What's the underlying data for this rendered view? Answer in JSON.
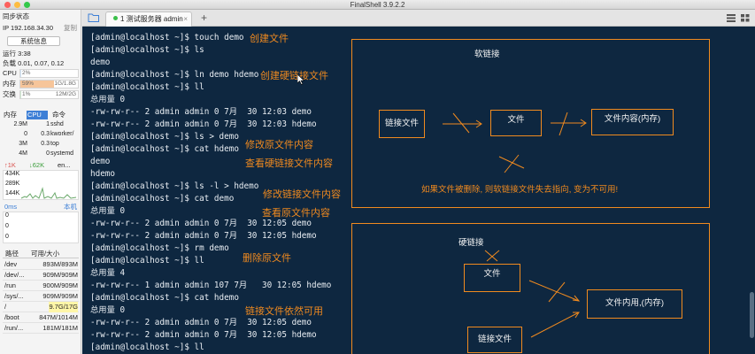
{
  "window": {
    "title": "FinalShell 3.9.2.2"
  },
  "sidebar": {
    "sync_status": "同步状态",
    "ip_label": "IP 192.168.34.30",
    "copy_label": "复制",
    "sysinfo_button": "系统信息",
    "uptime": "运行 3:38",
    "load": "负载 0.01, 0.07, 0.12",
    "cpu": {
      "label": "CPU",
      "percent": "2%",
      "fraction": 0.02
    },
    "mem": {
      "label": "内存",
      "percent": "59%",
      "value": "1G/1.8G",
      "fraction": 0.59
    },
    "swap": {
      "label": "交换",
      "percent": "1%",
      "value": "12M/2G",
      "fraction": 0.01
    },
    "proc_headers": {
      "mem": "内存",
      "cpu": "CPU",
      "cmd": "命令"
    },
    "processes": [
      {
        "mem": "2.9M",
        "cpu": "1",
        "cmd": "sshd"
      },
      {
        "mem": "0",
        "cpu": "0.3",
        "cmd": "kworker/"
      },
      {
        "mem": "3M",
        "cpu": "0.3",
        "cmd": "top"
      },
      {
        "mem": "4M",
        "cpu": "0",
        "cmd": "systemd"
      }
    ],
    "net": {
      "up": "↑1K",
      "down": "↓62K",
      "iface": "en...",
      "scale": [
        "434K",
        "289K",
        "144K"
      ]
    },
    "latency": {
      "label": "0ms",
      "host": "本机",
      "scale": [
        "0",
        "0",
        "0"
      ]
    },
    "disk_headers": {
      "path": "路径",
      "usage": "可用/大小"
    },
    "disks": [
      {
        "path": "/dev",
        "usage": "893M/893M"
      },
      {
        "path": "/dev/...",
        "usage": "909M/909M"
      },
      {
        "path": "/run",
        "usage": "900M/909M"
      },
      {
        "path": "/sys/...",
        "usage": "909M/909M"
      },
      {
        "path": "/",
        "usage": "9.7G/17G"
      },
      {
        "path": "/boot",
        "usage": "847M/1014M"
      },
      {
        "path": "/run/...",
        "usage": "181M/181M"
      }
    ]
  },
  "tabs": [
    {
      "label": "1 测试服务器 admin"
    }
  ],
  "terminal": {
    "lines": [
      "[admin@localhost ~]$ touch demo",
      "[admin@localhost ~]$ ls",
      "demo",
      "[admin@localhost ~]$ ln demo hdemo",
      "[admin@localhost ~]$ ll",
      "总用量 0",
      "-rw-rw-r-- 2 admin admin 0 7月  30 12:03 demo",
      "-rw-rw-r-- 2 admin admin 0 7月  30 12:03 hdemo",
      "[admin@localhost ~]$ ls > demo",
      "[admin@localhost ~]$ cat hdemo",
      "demo",
      "hdemo",
      "[admin@localhost ~]$ ls -l > hdemo",
      "[admin@localhost ~]$ cat demo",
      "总用量 0",
      "-rw-rw-r-- 2 admin admin 0 7月  30 12:05 demo",
      "-rw-rw-r-- 2 admin admin 0 7月  30 12:05 hdemo",
      "[admin@localhost ~]$ rm demo",
      "[admin@localhost ~]$ ll",
      "总用量 4",
      "-rw-rw-r-- 1 admin admin 107 7月   30 12:05 hdemo",
      "[admin@localhost ~]$ cat hdemo",
      "总用量 0",
      "-rw-rw-r-- 2 admin admin 0 7月  30 12:05 demo",
      "-rw-rw-r-- 2 admin admin 0 7月  30 12:05 hdemo",
      "[admin@localhost ~]$ ll"
    ],
    "notes": [
      "创建文件",
      "创建硬链接文件",
      "修改原文件内容",
      "查看硬链接文件内容",
      "修改链接文件内容",
      "查看原文件内容",
      "删除原文件",
      "链接文件依然可用"
    ],
    "softlink_panel": {
      "title": "软链接",
      "link_box": "链接文件",
      "file_box": "文件",
      "content_box": "文件内容(内存)",
      "caption": "如果文件被删除, 则软链接文件失去指向, 变为不可用!"
    },
    "hardlink_panel": {
      "title": "硬链接",
      "file_box": "文件",
      "content_box": "文件内用,(内存)",
      "link_box": "链接文件"
    }
  },
  "colors": {
    "terminal_bg": "#0e2740",
    "accent": "#f08a1f",
    "mem_bar": "#f6c59a",
    "cpu_selected": "#3d7fd6"
  }
}
